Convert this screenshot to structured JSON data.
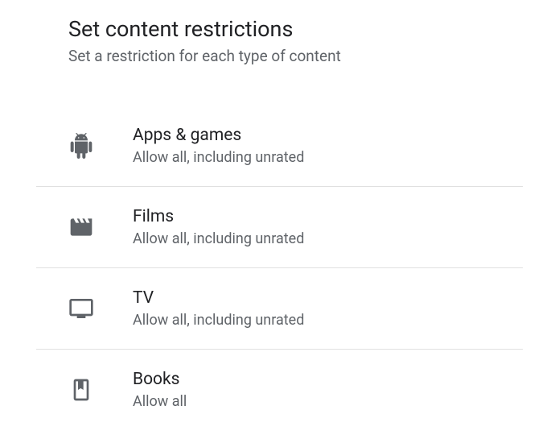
{
  "header": {
    "title": "Set content restrictions",
    "subtitle": "Set a restriction for each type of content"
  },
  "items": [
    {
      "label": "Apps & games",
      "value": "Allow all, including unrated"
    },
    {
      "label": "Films",
      "value": "Allow all, including unrated"
    },
    {
      "label": "TV",
      "value": "Allow all, including unrated"
    },
    {
      "label": "Books",
      "value": "Allow all"
    }
  ]
}
